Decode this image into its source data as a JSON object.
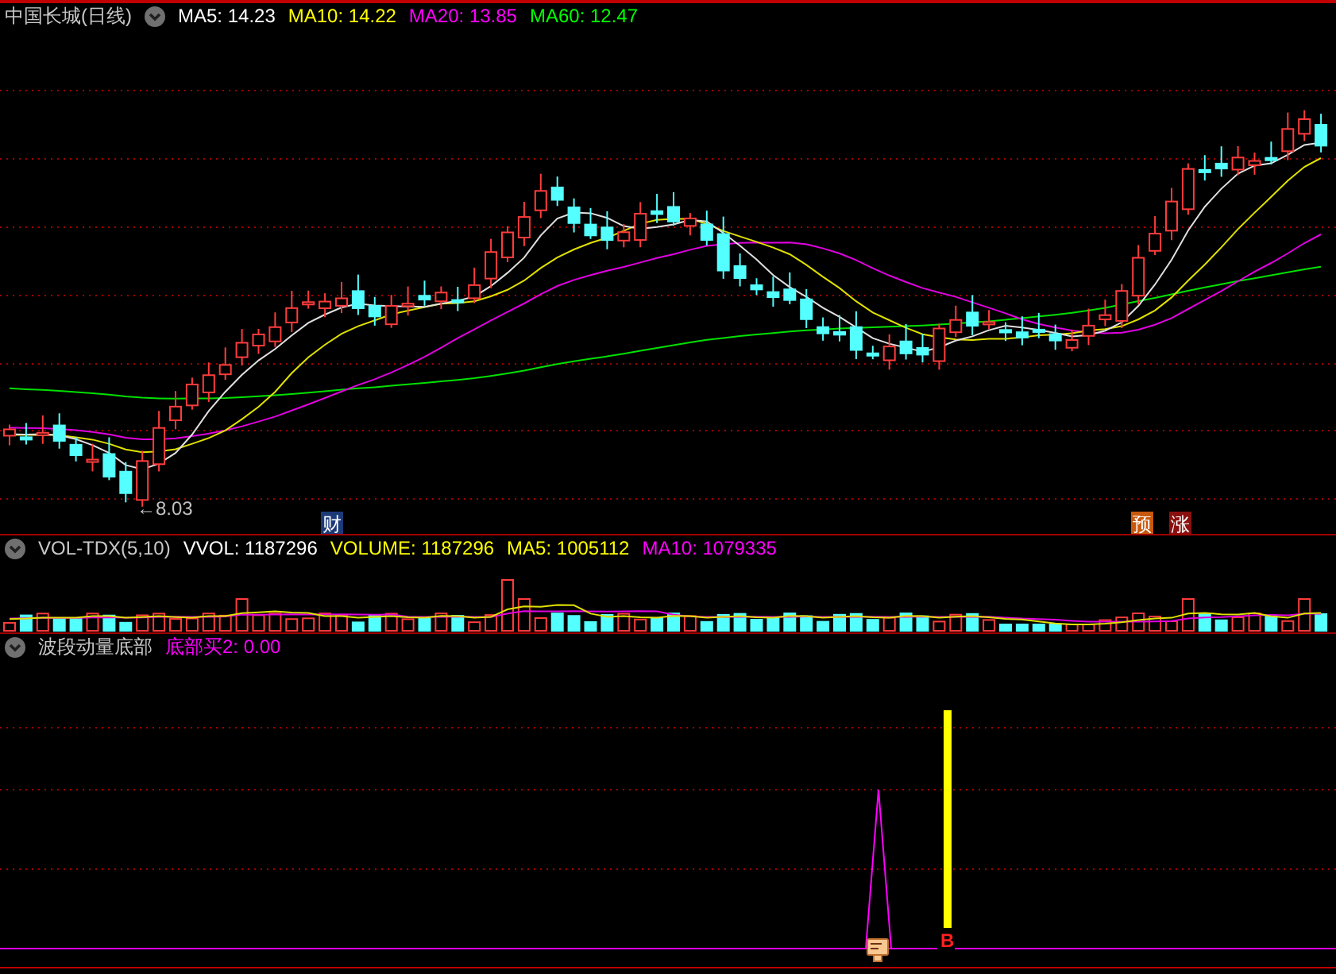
{
  "main_panel": {
    "title": "中国长城(日线)",
    "indicators": [
      {
        "label": "MA5: 14.23",
        "color": "#ffffff"
      },
      {
        "label": "MA10: 14.22",
        "color": "#ffff00"
      },
      {
        "label": "MA20: 13.85",
        "color": "#ff00ff"
      },
      {
        "label": "MA60: 12.47",
        "color": "#00ff00"
      }
    ],
    "low_label": "←8.03",
    "markers": [
      {
        "text": "财",
        "color": "#1c3a78"
      },
      {
        "text": "预",
        "color": "#c8580c"
      },
      {
        "text": "涨",
        "color": "#8a1010"
      }
    ]
  },
  "volume_panel": {
    "title": "VOL-TDX(5,10)",
    "indicators": [
      {
        "label": "VVOL: 1187296",
        "color": "#ffffff"
      },
      {
        "label": "VOLUME: 1187296",
        "color": "#ffff00"
      },
      {
        "label": "MA5: 1005112",
        "color": "#ffff00"
      },
      {
        "label": "MA10: 1079335",
        "color": "#ff00ff"
      }
    ]
  },
  "signal_panel": {
    "title": "波段动量底部",
    "indicators": [
      {
        "label": "底部买2: 0.00",
        "color": "#ff00ff"
      }
    ],
    "signal_mark": "B"
  }
}
